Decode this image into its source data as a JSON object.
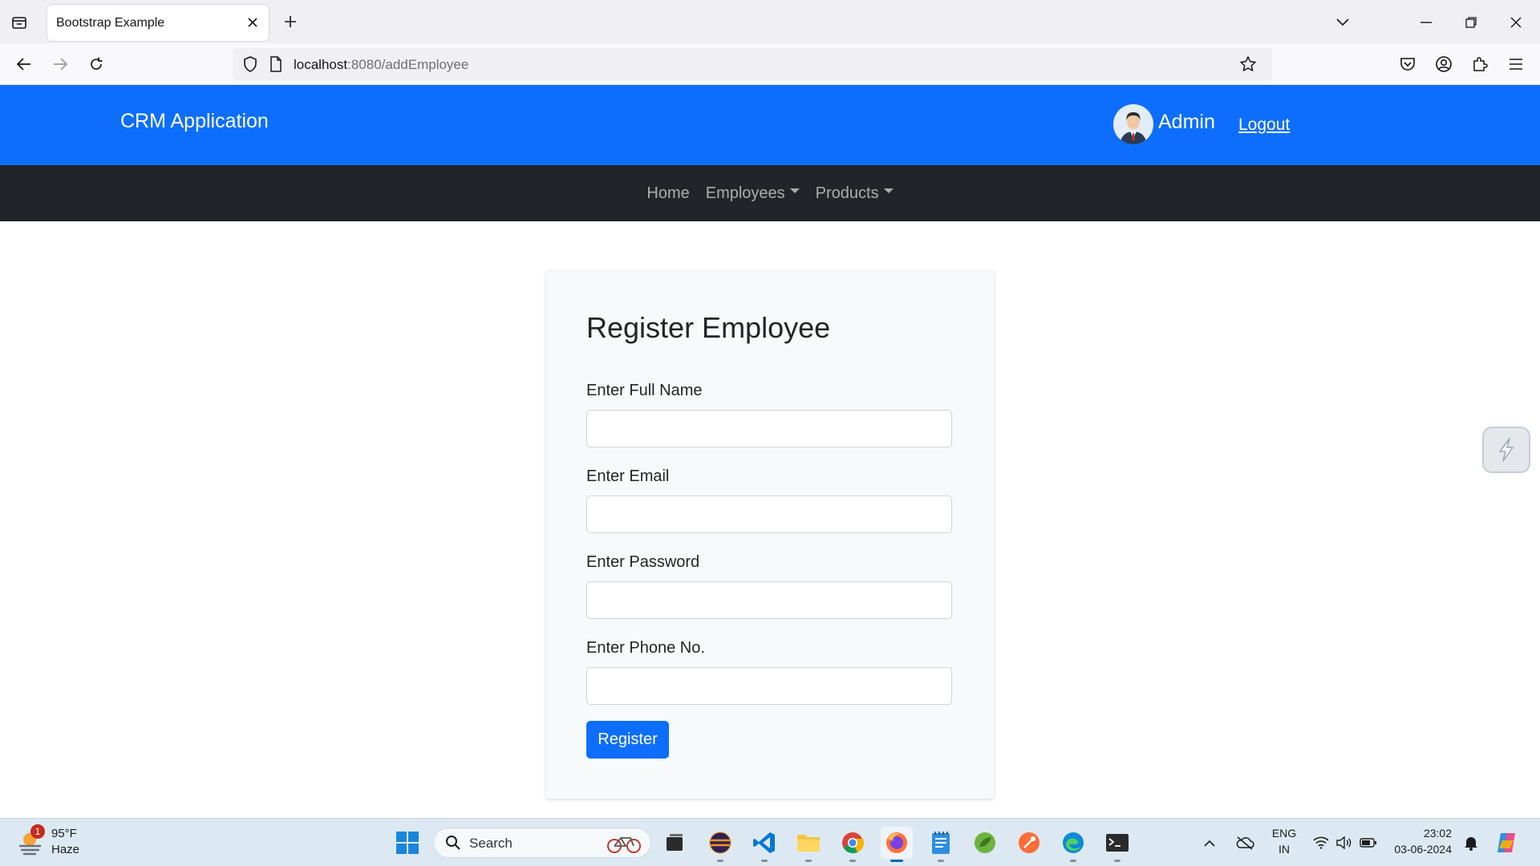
{
  "browser": {
    "tab_title": "Bootstrap Example",
    "url_host": "localhost",
    "url_rest": ":8080/addEmployee"
  },
  "header": {
    "brand": "CRM Application",
    "user_name": "Admin",
    "logout_label": "Logout"
  },
  "nav": {
    "home": "Home",
    "employees": "Employees",
    "products": "Products"
  },
  "form": {
    "title": "Register Employee",
    "fields": [
      {
        "label": "Enter Full Name",
        "value": "",
        "placeholder": ""
      },
      {
        "label": "Enter Email",
        "value": "",
        "placeholder": ""
      },
      {
        "label": "Enter Password",
        "value": "",
        "placeholder": ""
      },
      {
        "label": "Enter Phone No.",
        "value": "",
        "placeholder": ""
      }
    ],
    "submit_label": "Register"
  },
  "taskbar": {
    "weather_badge": "1",
    "weather_temp": "95°F",
    "weather_condition": "Haze",
    "search_label": "Search",
    "lang_top": "ENG",
    "lang_bottom": "IN",
    "time": "23:02",
    "date": "03-06-2024"
  },
  "colors": {
    "header_blue": "#0d6efd",
    "nav_dark": "#212529",
    "card_bg": "#f8f9fa"
  }
}
